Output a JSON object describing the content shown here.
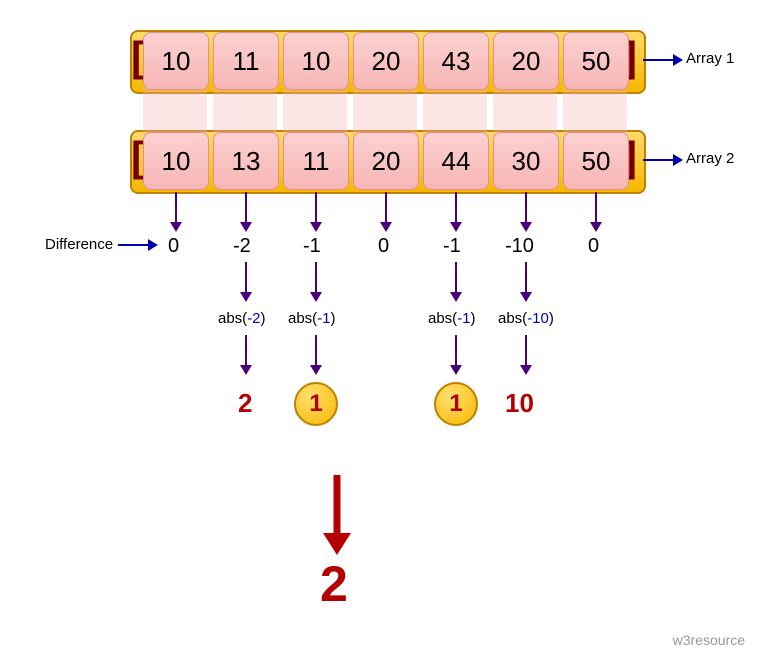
{
  "labels": {
    "array1": "Array 1",
    "array2": "Array 2",
    "difference": "Difference"
  },
  "array1": [
    "10",
    "11",
    "10",
    "20",
    "43",
    "20",
    "50"
  ],
  "array2": [
    "10",
    "13",
    "11",
    "20",
    "44",
    "30",
    "50"
  ],
  "diff": [
    "0",
    "-2",
    "-1",
    "0",
    "-1",
    "-10",
    "0"
  ],
  "abs": {
    "c1": {
      "expr_prefix": "abs(",
      "expr_val": "-2",
      "expr_suffix": ")",
      "val": "2"
    },
    "c2": {
      "expr_prefix": "abs(",
      "expr_val": "-1",
      "expr_suffix": ")",
      "val": "1"
    },
    "c4": {
      "expr_prefix": "abs(",
      "expr_val": "-1",
      "expr_suffix": ")",
      "val": "1"
    },
    "c5": {
      "expr_prefix": "abs(",
      "expr_val": "-10",
      "expr_suffix": ")",
      "val": "10"
    }
  },
  "final": "2",
  "watermark": "w3resource"
}
